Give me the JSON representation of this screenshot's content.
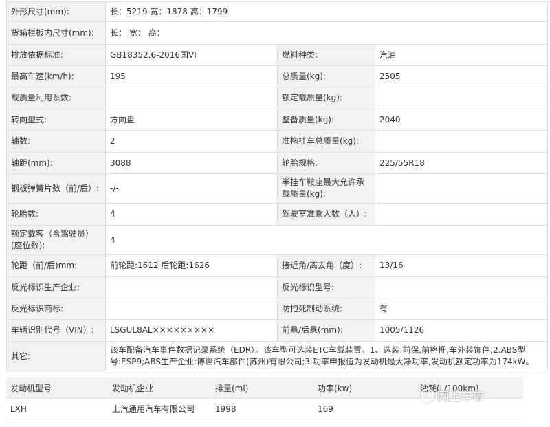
{
  "spec_rows": [
    {
      "cells": [
        {
          "t": "外形尺寸(mm):",
          "k": "lbl"
        },
        {
          "t": "长：5219 宽：1878 高：1799",
          "k": "val",
          "span": 3
        }
      ],
      "h": 29
    },
    {
      "cells": [
        {
          "t": "货箱栏板内尺寸(mm):",
          "k": "lbl"
        },
        {
          "t": "长： 宽： 高：",
          "k": "val",
          "span": 3
        }
      ],
      "h": 33
    },
    {
      "cells": [
        {
          "t": "排放依据标准:",
          "k": "lbl"
        },
        {
          "t": "GB18352.6-2016国VI",
          "k": "val"
        },
        {
          "t": "燃料种类:",
          "k": "lbl"
        },
        {
          "t": "汽油",
          "k": "val"
        }
      ],
      "h": 31
    },
    {
      "cells": [
        {
          "t": "最高车速(km/h):",
          "k": "lbl"
        },
        {
          "t": "195",
          "k": "val"
        },
        {
          "t": "总质量(kg):",
          "k": "lbl"
        },
        {
          "t": "2505",
          "k": "val"
        }
      ],
      "h": 31
    },
    {
      "cells": [
        {
          "t": "载质量利用系数:",
          "k": "lbl"
        },
        {
          "t": "",
          "k": "val"
        },
        {
          "t": "额定载质量(kg):",
          "k": "lbl"
        },
        {
          "t": "",
          "k": "val"
        }
      ],
      "h": 32
    },
    {
      "cells": [
        {
          "t": "转向型式:",
          "k": "lbl"
        },
        {
          "t": "方向盘",
          "k": "val"
        },
        {
          "t": "整备质量(kg):",
          "k": "lbl"
        },
        {
          "t": "2040",
          "k": "val"
        }
      ],
      "h": 31
    },
    {
      "cells": [
        {
          "t": "轴数:",
          "k": "lbl"
        },
        {
          "t": "2",
          "k": "val"
        },
        {
          "t": "准拖挂车总质量(kg):",
          "k": "lbl"
        },
        {
          "t": "",
          "k": "val"
        }
      ],
      "h": 32
    },
    {
      "cells": [
        {
          "t": "轴距(mm):",
          "k": "lbl"
        },
        {
          "t": "3088",
          "k": "val"
        },
        {
          "t": "轮胎规格:",
          "k": "lbl"
        },
        {
          "t": "225/55R18",
          "k": "val"
        }
      ],
      "h": 31
    },
    {
      "cells": [
        {
          "t": "钢板弹簧片数（前/后）:",
          "k": "lbl"
        },
        {
          "t": "-/-",
          "k": "val"
        },
        {
          "t": "半挂车鞍座最大允许承载质量(kg):",
          "k": "lbl"
        },
        {
          "t": "",
          "k": "val"
        }
      ],
      "h": 43
    },
    {
      "cells": [
        {
          "t": "轮胎数:",
          "k": "lbl"
        },
        {
          "t": "4",
          "k": "val"
        },
        {
          "t": "驾驶室准乘人数（人）:",
          "k": "lbl"
        },
        {
          "t": "",
          "k": "val"
        }
      ],
      "h": 32
    },
    {
      "cells": [
        {
          "t": "额定载客（含驾驶员）(座位数):",
          "k": "lbl"
        },
        {
          "t": "4",
          "k": "val",
          "span": 3
        }
      ],
      "h": 43
    },
    {
      "cells": [
        {
          "t": "轮距（前/后)mm:",
          "k": "lbl"
        },
        {
          "t": "前轮距:1612 后轮距:1626",
          "k": "val"
        },
        {
          "t": "接近角/离去角（度）:",
          "k": "lbl"
        },
        {
          "t": "13/16",
          "k": "val"
        }
      ],
      "h": 32
    },
    {
      "cells": [
        {
          "t": "反光标识生产企业:",
          "k": "lbl"
        },
        {
          "t": "",
          "k": "val"
        },
        {
          "t": "反光标识型号:",
          "k": "lbl"
        },
        {
          "t": "",
          "k": "val"
        }
      ],
      "h": 31
    },
    {
      "cells": [
        {
          "t": "反光标识商标:",
          "k": "lbl"
        },
        {
          "t": "",
          "k": "val"
        },
        {
          "t": "防抱死制动系统:",
          "k": "lbl"
        },
        {
          "t": "有",
          "k": "val"
        }
      ],
      "h": 31
    },
    {
      "cells": [
        {
          "t": "车辆识别代号（VIN）:",
          "k": "lbl"
        },
        {
          "t": "LSGUL8AL×××××××××",
          "k": "val"
        },
        {
          "t": "前悬/后悬(mm):",
          "k": "lbl"
        },
        {
          "t": "1005/1126",
          "k": "val"
        }
      ],
      "h": 32
    },
    {
      "cells": [
        {
          "t": "其它:",
          "k": "lbl"
        },
        {
          "t": "该车配备汽车事件数据记录系统（EDR）。该车型可选装ETC车载装置。1、选装:前保,前格栅,车外装饰件;2.ABS型号:ESP9;ABS生产企业:博世汽车部件(苏州)有限公司;3.功率申报值为发动机最大净功率,发动机额定功率为174kW。",
          "k": "val",
          "span": 3
        }
      ],
      "h": 43
    }
  ],
  "engine": {
    "headers": [
      "发动机型号",
      "发动机企业",
      "排量(ml)",
      "功率(kw)",
      "油耗(L/100km)"
    ],
    "rows": [
      [
        "LXH",
        "上汽通用汽车有限公司",
        "1998",
        "169",
        ""
      ]
    ]
  },
  "watermark": {
    "text": "网上车市",
    "icon": "wheel-icon"
  }
}
